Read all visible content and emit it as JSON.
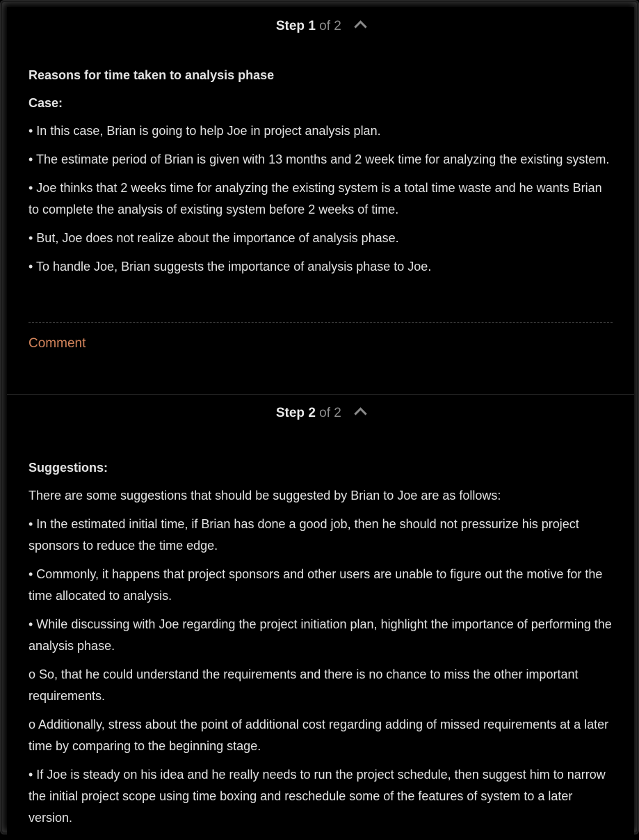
{
  "step1": {
    "step_label": "Step",
    "step_number": "1",
    "step_of": "of 2",
    "title": "Reasons for time taken to analysis phase",
    "case_label": "Case:",
    "bullets": [
      "• In this case, Brian is going to help Joe in project analysis plan.",
      "• The estimate period of Brian is given with 13 months and 2 week time for analyzing the existing system.",
      "• Joe thinks that 2 weeks time for analyzing the existing system is a total time waste and he wants Brian to complete the analysis of existing system before 2 weeks of time.",
      "• But, Joe does not realize about the importance of analysis phase.",
      "• To handle Joe, Brian suggests the importance of analysis phase to Joe."
    ],
    "comment_label": "Comment"
  },
  "step2": {
    "step_label": "Step",
    "step_number": "2",
    "step_of": "of 2",
    "suggestions_label": "Suggestions:",
    "intro": "There are some suggestions that should be suggested by Brian to Joe are as follows:",
    "items": [
      "• In the estimated initial time, if Brian has done a good job, then he should not pressurize his project sponsors to reduce the time edge.",
      "• Commonly, it happens that project sponsors and other users are unable to figure out the motive for the time allocated to analysis.",
      "• While discussing with Joe regarding the project initiation plan, highlight the importance of performing the analysis phase.",
      "o So, that he could understand the requirements and there is no chance to miss the other important requirements.",
      "o Additionally, stress about the point of additional cost regarding adding of missed requirements at a later time by comparing to the beginning stage.",
      "• If Joe is steady on his idea and he really needs to run the project schedule, then suggest him to narrow the initial project scope using time boxing and reschedule some of the features of system to a later version."
    ]
  },
  "colors": {
    "background": "#000000",
    "text": "#e3e3e3",
    "muted": "#8c8c8c",
    "link": "#d3845b"
  },
  "icons": {
    "collapse": "chevron-up-icon"
  }
}
